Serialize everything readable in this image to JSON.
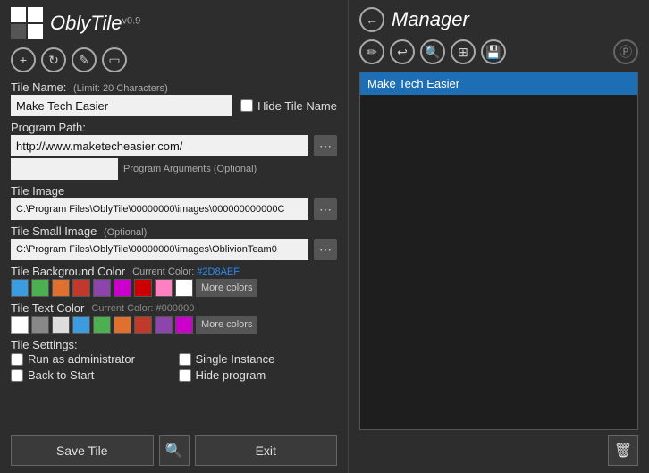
{
  "app": {
    "title": "OblyTile",
    "version": "v0.9"
  },
  "left": {
    "tile_name_label": "Tile Name:",
    "tile_name_sublabel": "(Limit: 20 Characters)",
    "tile_name_value": "Make Tech Easier",
    "hide_tile_name_label": "Hide Tile Name",
    "hide_tile_name_checked": false,
    "program_path_label": "Program Path:",
    "program_path_value": "http://www.maketecheasier.com/",
    "program_args_placeholder": "Program Arguments (Optional)",
    "tile_image_label": "Tile Image",
    "tile_image_value": "C:\\Program Files\\OblyTile\\00000000\\images\\000000000000C",
    "tile_small_image_label": "Tile Small Image",
    "tile_small_image_sublabel": "(Optional)",
    "tile_small_image_value": "C:\\Program Files\\OblyTile\\00000000\\images\\OblivionTeam0",
    "tile_bg_color_label": "Tile Background Color",
    "tile_bg_current_color_label": "Current Color:",
    "tile_bg_current_color_value": "#2D8AEF",
    "tile_text_color_label": "Tile Text Color",
    "tile_text_current_color_label": "Current Color:",
    "tile_text_current_color_value": "#000000",
    "more_colors_label": "More colors",
    "tile_settings_label": "Tile Settings:",
    "run_as_admin_label": "Run as administrator",
    "run_as_admin_checked": false,
    "single_instance_label": "Single Instance",
    "single_instance_checked": false,
    "back_to_start_label": "Back to Start",
    "back_to_start_checked": false,
    "hide_program_label": "Hide program",
    "hide_program_checked": false,
    "save_label": "Save Tile",
    "exit_label": "Exit",
    "bg_swatches": [
      {
        "color": "#3b9de0",
        "name": "blue"
      },
      {
        "color": "#4caf50",
        "name": "green"
      },
      {
        "color": "#e07030",
        "name": "orange"
      },
      {
        "color": "#c0392b",
        "name": "darkred"
      },
      {
        "color": "#8e44ad",
        "name": "purple"
      },
      {
        "color": "#cc00cc",
        "name": "magenta"
      },
      {
        "color": "#cc0000",
        "name": "red"
      },
      {
        "color": "#ff80c0",
        "name": "pink"
      },
      {
        "color": "#ffffff",
        "name": "white"
      }
    ],
    "text_swatches": [
      {
        "color": "#ffffff",
        "name": "white"
      },
      {
        "color": "#888888",
        "name": "gray"
      },
      {
        "color": "#dddddd",
        "name": "lightgray"
      },
      {
        "color": "#3b9de0",
        "name": "blue"
      },
      {
        "color": "#4caf50",
        "name": "green"
      },
      {
        "color": "#e07030",
        "name": "orange"
      },
      {
        "color": "#c0392b",
        "name": "darkred"
      },
      {
        "color": "#8e44ad",
        "name": "purple"
      },
      {
        "color": "#cc00cc",
        "name": "magenta"
      }
    ]
  },
  "right": {
    "title": "Manager",
    "list_items": [
      {
        "label": "Make Tech Easier",
        "selected": true
      }
    ],
    "icons": {
      "edit": "✏",
      "undo": "↩",
      "search": "🔍",
      "windows": "⊞",
      "save": "💾",
      "p_icon": "Ⓟ",
      "delete": "🗑",
      "back": "←"
    }
  },
  "toolbar": {
    "add_icon": "+",
    "refresh_icon": "↻",
    "edit_icon": "✎",
    "folder_icon": "📁"
  }
}
